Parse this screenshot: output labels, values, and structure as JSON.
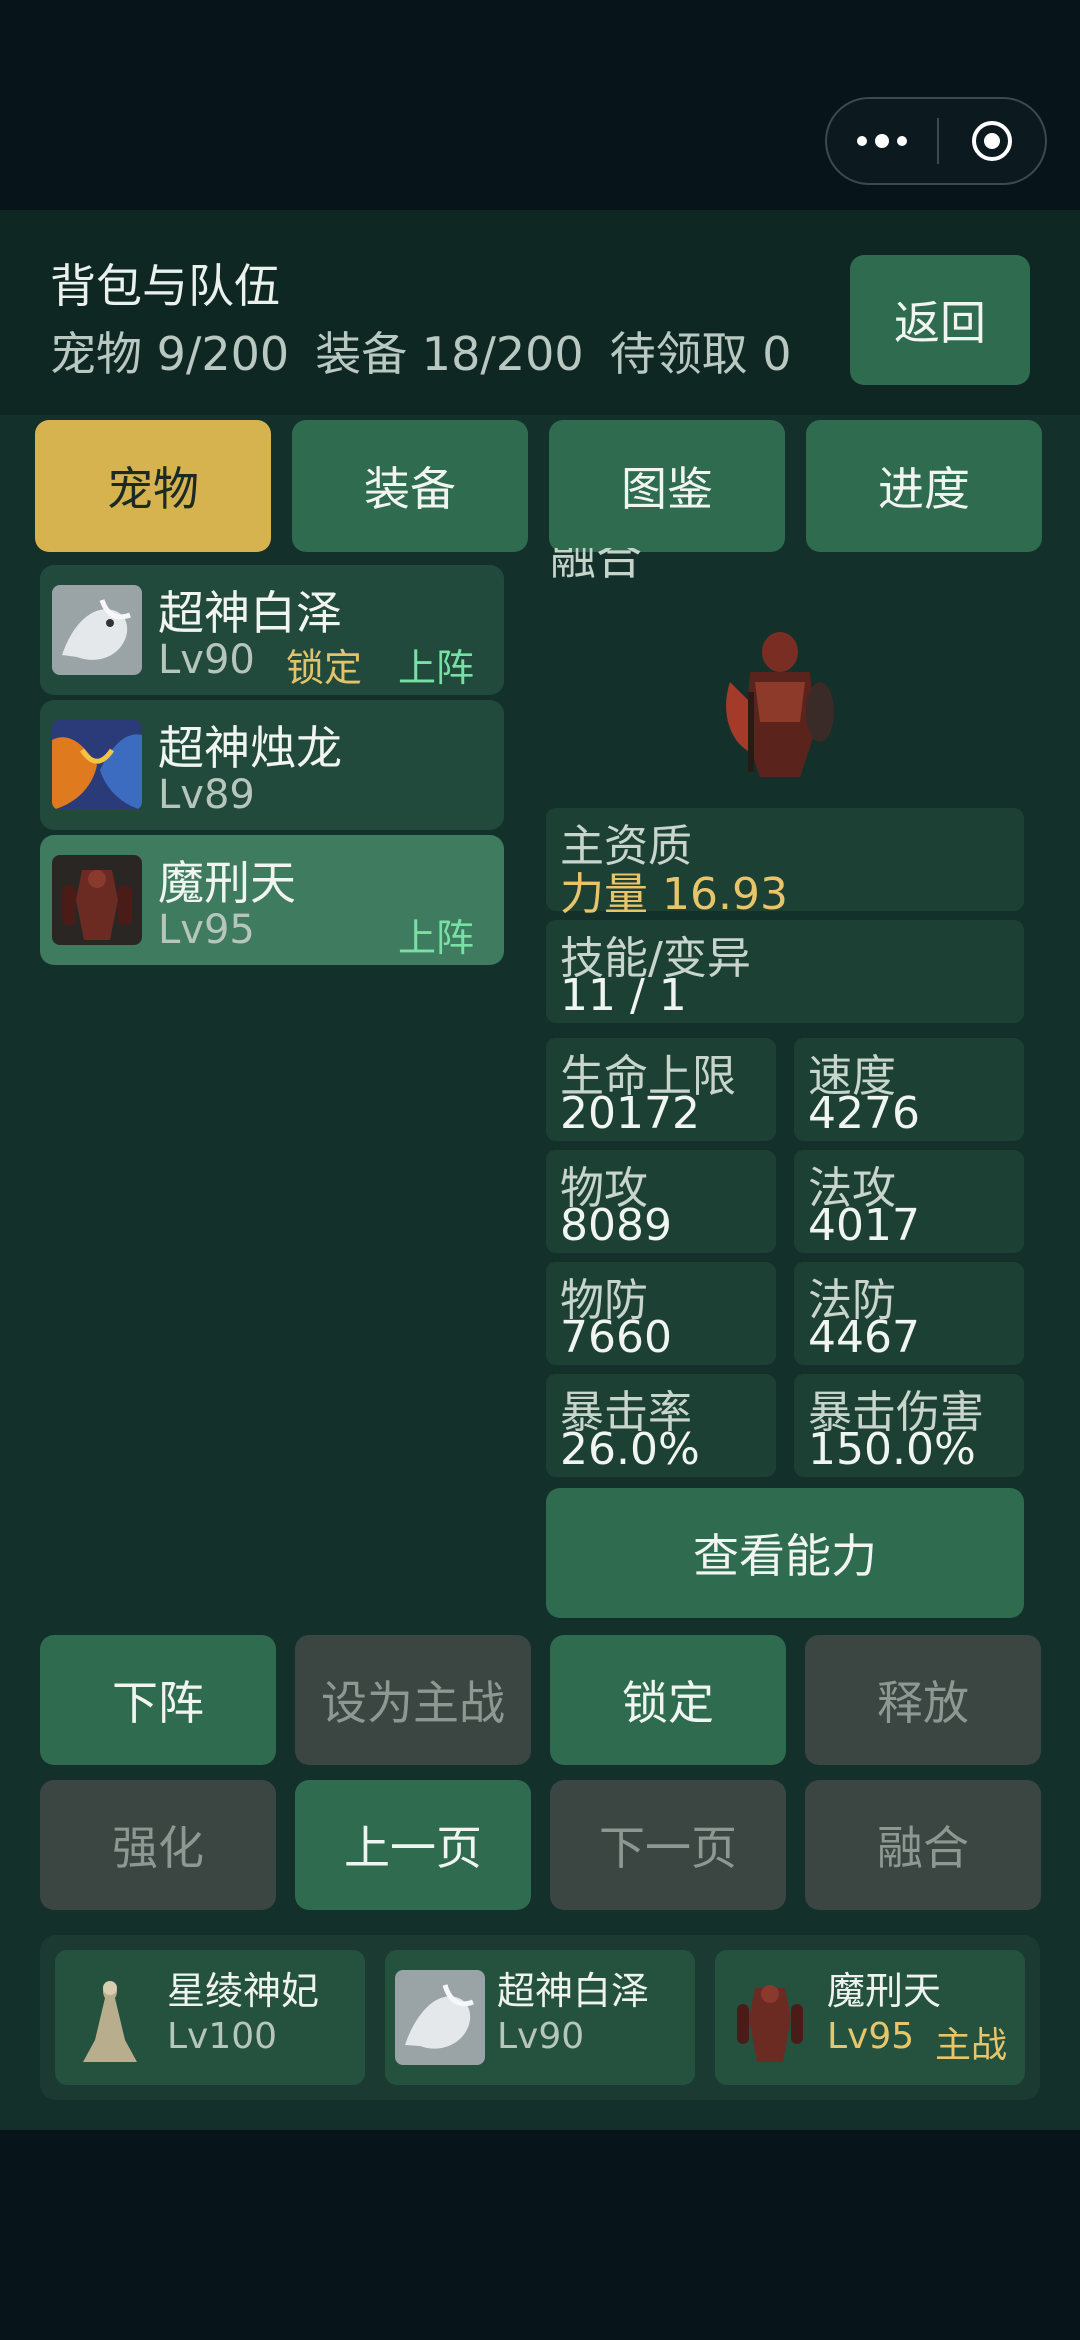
{
  "header": {
    "title": "背包与队伍",
    "pets_count": "宠物 9/200",
    "equip_count": "装备 18/200",
    "pending": "待领取 0",
    "back_label": "返回"
  },
  "tabs": [
    {
      "label": "宠物",
      "active": true
    },
    {
      "label": "装备"
    },
    {
      "label": "图鉴"
    },
    {
      "label": "进度"
    }
  ],
  "pet_list": [
    {
      "name": "超神白泽",
      "level": "Lv90",
      "locked": "锁定",
      "deployed": "上阵",
      "icon": "white-dragon-icon"
    },
    {
      "name": "超神烛龙",
      "level": "Lv89",
      "icon": "fire-dragon-icon"
    },
    {
      "name": "魔刑天",
      "level": "Lv95",
      "deployed": "上阵",
      "icon": "warrior-icon",
      "selected": true
    }
  ],
  "detail": {
    "title_partial": "融合",
    "main_quality_label": "主资质",
    "main_quality_value": "力量 16.93",
    "skills_label": "技能/变异",
    "skills_value": "11 / 1",
    "stats": [
      {
        "label": "生命上限",
        "value": "20172"
      },
      {
        "label": "速度",
        "value": "4276"
      },
      {
        "label": "物攻",
        "value": "8089"
      },
      {
        "label": "法攻",
        "value": "4017"
      },
      {
        "label": "物防",
        "value": "7660"
      },
      {
        "label": "法防",
        "value": "4467"
      },
      {
        "label": "暴击率",
        "value": "26.0%"
      },
      {
        "label": "暴击伤害",
        "value": "150.0%"
      }
    ],
    "view_ability_label": "查看能力"
  },
  "actions": {
    "row1": [
      "下阵",
      "设为主战",
      "锁定",
      "释放"
    ],
    "row2": [
      "强化",
      "上一页",
      "下一页",
      "融合"
    ]
  },
  "team": [
    {
      "name": "星绫神妃",
      "level": "Lv100"
    },
    {
      "name": "超神白泽",
      "level": "Lv90"
    },
    {
      "name": "魔刑天",
      "level": "Lv95",
      "main": "主战"
    }
  ],
  "colors": {
    "accent_green": "#2e6b4f",
    "active_tab": "#d6b34f",
    "gold_text": "#e8c56b",
    "deploy_text": "#78e0a4"
  }
}
